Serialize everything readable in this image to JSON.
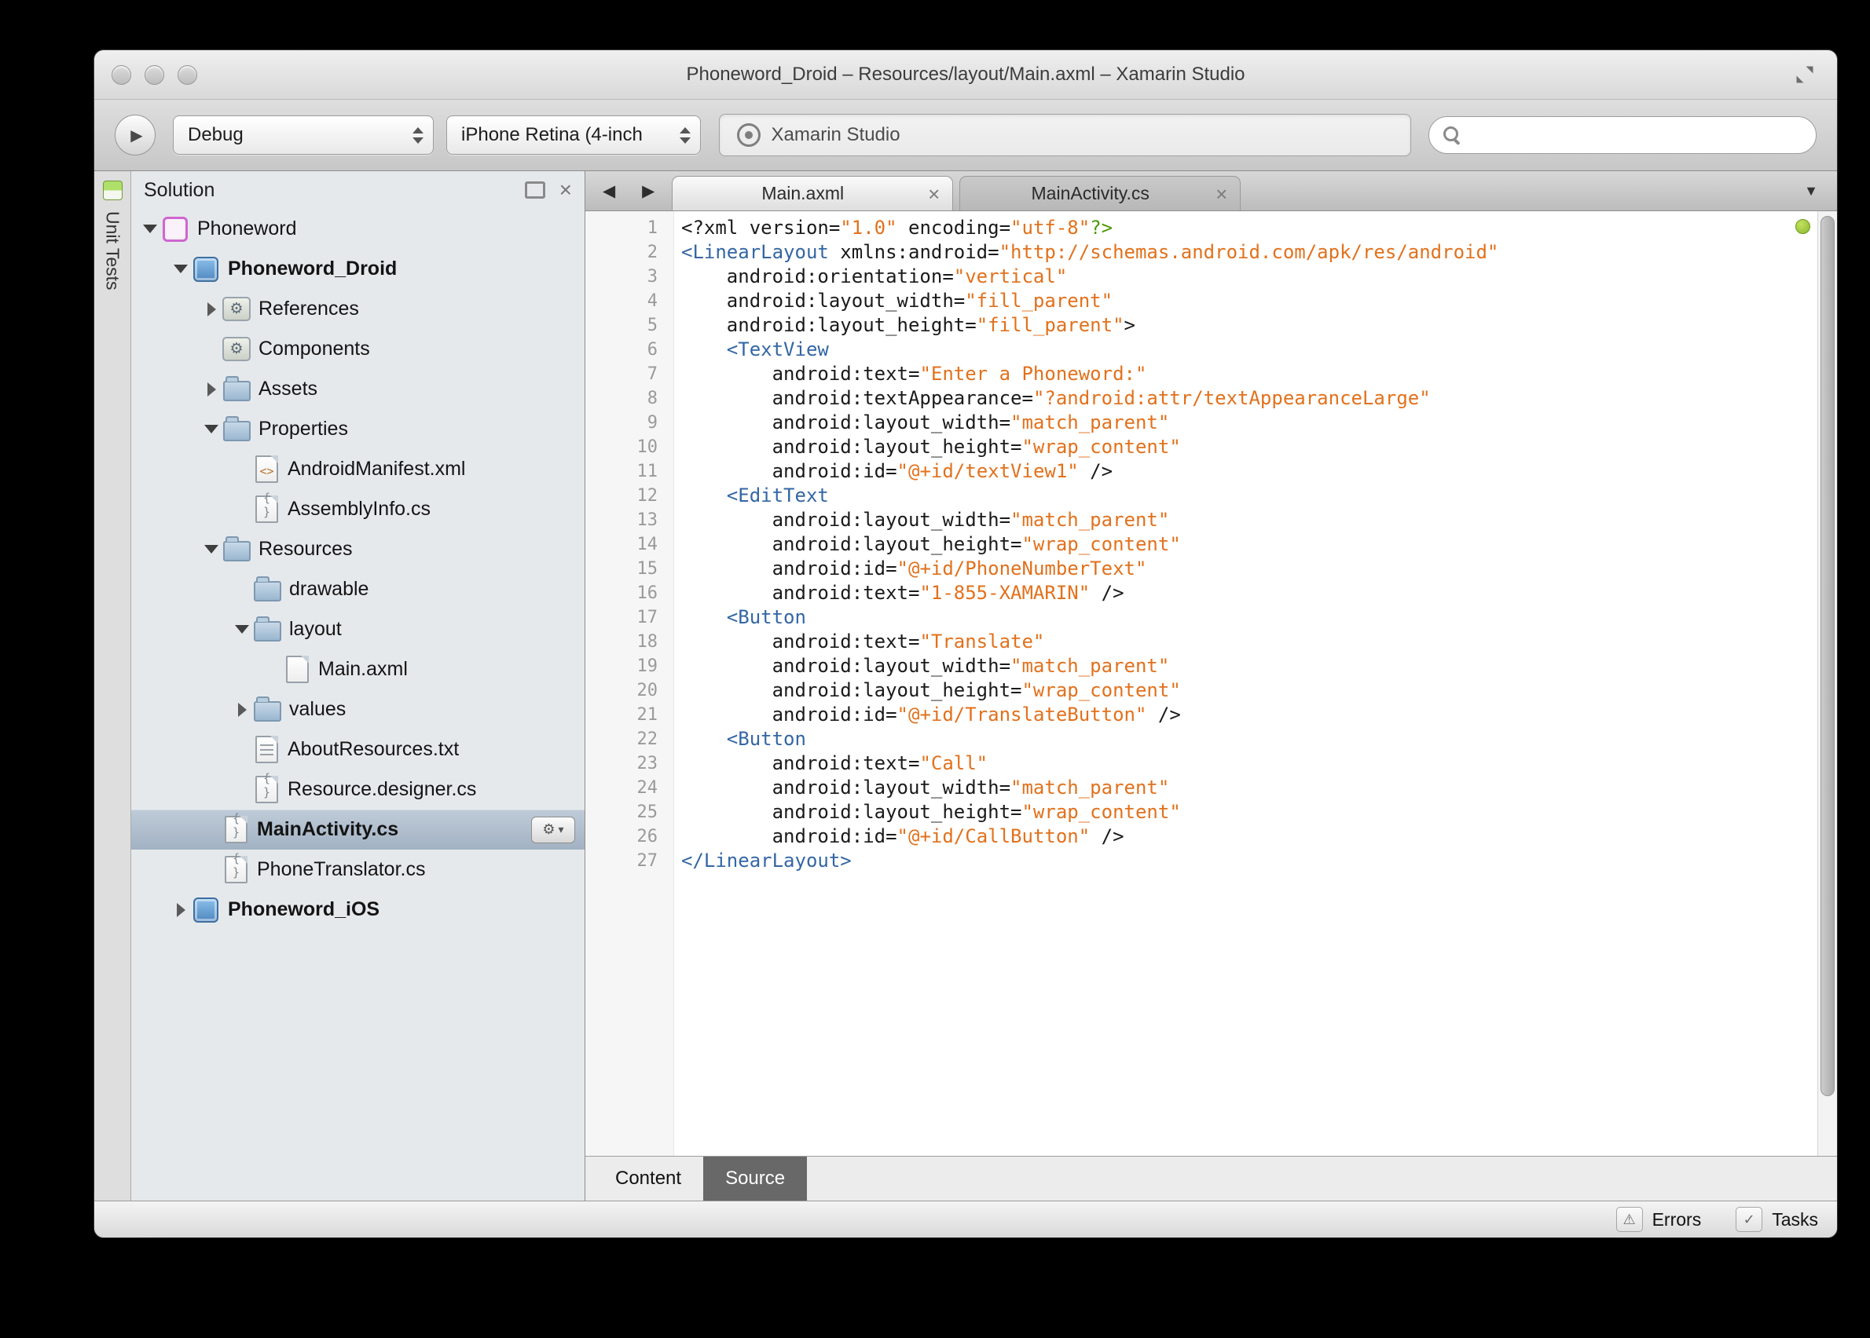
{
  "window": {
    "title": "Phoneword_Droid – Resources/layout/Main.axml – Xamarin Studio"
  },
  "toolbar": {
    "configuration": "Debug",
    "device": "iPhone Retina (4-inch",
    "status_text": "Xamarin Studio"
  },
  "unit_tests_label": "Unit Tests",
  "solution_panel": {
    "title": "Solution",
    "tree": [
      {
        "label": "Phoneword",
        "level": 0,
        "expander": "down",
        "icon": "solution"
      },
      {
        "label": "Phoneword_Droid",
        "level": 1,
        "expander": "down",
        "icon": "project",
        "bold": true
      },
      {
        "label": "References",
        "level": 2,
        "expander": "right",
        "icon": "references"
      },
      {
        "label": "Components",
        "level": 2,
        "expander": "none",
        "icon": "components"
      },
      {
        "label": "Assets",
        "level": 2,
        "expander": "right",
        "icon": "folder"
      },
      {
        "label": "Properties",
        "level": 2,
        "expander": "down",
        "icon": "folder"
      },
      {
        "label": "AndroidManifest.xml",
        "level": 3,
        "expander": "none",
        "icon": "file-xml"
      },
      {
        "label": "AssemblyInfo.cs",
        "level": 3,
        "expander": "none",
        "icon": "file-cs"
      },
      {
        "label": "Resources",
        "level": 2,
        "expander": "down",
        "icon": "folder"
      },
      {
        "label": "drawable",
        "level": 3,
        "expander": "none",
        "icon": "folder"
      },
      {
        "label": "layout",
        "level": 3,
        "expander": "down",
        "icon": "folder"
      },
      {
        "label": "Main.axml",
        "level": 4,
        "expander": "none",
        "icon": "file-plain"
      },
      {
        "label": "values",
        "level": 3,
        "expander": "right",
        "icon": "folder"
      },
      {
        "label": "AboutResources.txt",
        "level": 3,
        "expander": "none",
        "icon": "file-txt"
      },
      {
        "label": "Resource.designer.cs",
        "level": 3,
        "expander": "none",
        "icon": "file-cs"
      },
      {
        "label": "MainActivity.cs",
        "level": 2,
        "expander": "none",
        "icon": "file-cs",
        "selected": true,
        "gear": true,
        "bold": true
      },
      {
        "label": "PhoneTranslator.cs",
        "level": 2,
        "expander": "none",
        "icon": "file-cs"
      },
      {
        "label": "Phoneword_iOS",
        "level": 1,
        "expander": "right",
        "icon": "project",
        "bold": true
      }
    ]
  },
  "editor": {
    "tabs": [
      {
        "label": "Main.axml",
        "active": true
      },
      {
        "label": "MainActivity.cs",
        "active": false
      }
    ],
    "bottom_tabs": [
      {
        "label": "Content",
        "active": false
      },
      {
        "label": "Source",
        "active": true
      }
    ],
    "code_lines": [
      {
        "n": 1,
        "tokens": [
          [
            "p",
            "<?xml version="
          ],
          [
            "v",
            "\"1.0\""
          ],
          [
            "p",
            " encoding="
          ],
          [
            "v",
            "\"utf-8\""
          ],
          [
            "g",
            "?>"
          ]
        ]
      },
      {
        "n": 2,
        "tokens": [
          [
            "t",
            "<LinearLayout"
          ],
          [
            "p",
            " xmlns:android="
          ],
          [
            "v",
            "\"http://schemas.android.com/apk/res/android\""
          ]
        ]
      },
      {
        "n": 3,
        "tokens": [
          [
            "p",
            "    android:orientation="
          ],
          [
            "v",
            "\"vertical\""
          ]
        ]
      },
      {
        "n": 4,
        "tokens": [
          [
            "p",
            "    android:layout_width="
          ],
          [
            "v",
            "\"fill_parent\""
          ]
        ]
      },
      {
        "n": 5,
        "tokens": [
          [
            "p",
            "    android:layout_height="
          ],
          [
            "v",
            "\"fill_parent\""
          ],
          [
            "p",
            ">"
          ]
        ]
      },
      {
        "n": 6,
        "tokens": [
          [
            "p",
            "    "
          ],
          [
            "t",
            "<TextView"
          ]
        ]
      },
      {
        "n": 7,
        "tokens": [
          [
            "p",
            "        android:text="
          ],
          [
            "v",
            "\"Enter a Phoneword:\""
          ]
        ]
      },
      {
        "n": 8,
        "tokens": [
          [
            "p",
            "        android:textAppearance="
          ],
          [
            "v",
            "\"?android:attr/textAppearanceLarge\""
          ]
        ]
      },
      {
        "n": 9,
        "tokens": [
          [
            "p",
            "        android:layout_width="
          ],
          [
            "v",
            "\"match_parent\""
          ]
        ]
      },
      {
        "n": 10,
        "tokens": [
          [
            "p",
            "        android:layout_height="
          ],
          [
            "v",
            "\"wrap_content\""
          ]
        ]
      },
      {
        "n": 11,
        "tokens": [
          [
            "p",
            "        android:id="
          ],
          [
            "v",
            "\"@+id/textView1\""
          ],
          [
            "p",
            " />"
          ]
        ]
      },
      {
        "n": 12,
        "tokens": [
          [
            "p",
            "    "
          ],
          [
            "t",
            "<EditText"
          ]
        ]
      },
      {
        "n": 13,
        "tokens": [
          [
            "p",
            "        android:layout_width="
          ],
          [
            "v",
            "\"match_parent\""
          ]
        ]
      },
      {
        "n": 14,
        "tokens": [
          [
            "p",
            "        android:layout_height="
          ],
          [
            "v",
            "\"wrap_content\""
          ]
        ]
      },
      {
        "n": 15,
        "tokens": [
          [
            "p",
            "        android:id="
          ],
          [
            "v",
            "\"@+id/PhoneNumberText\""
          ]
        ]
      },
      {
        "n": 16,
        "tokens": [
          [
            "p",
            "        android:text="
          ],
          [
            "v",
            "\"1-855-XAMARIN\""
          ],
          [
            "p",
            " />"
          ]
        ]
      },
      {
        "n": 17,
        "tokens": [
          [
            "p",
            "    "
          ],
          [
            "t",
            "<Button"
          ]
        ]
      },
      {
        "n": 18,
        "tokens": [
          [
            "p",
            "        android:text="
          ],
          [
            "v",
            "\"Translate\""
          ]
        ]
      },
      {
        "n": 19,
        "tokens": [
          [
            "p",
            "        android:layout_width="
          ],
          [
            "v",
            "\"match_parent\""
          ]
        ]
      },
      {
        "n": 20,
        "tokens": [
          [
            "p",
            "        android:layout_height="
          ],
          [
            "v",
            "\"wrap_content\""
          ]
        ]
      },
      {
        "n": 21,
        "tokens": [
          [
            "p",
            "        android:id="
          ],
          [
            "v",
            "\"@+id/TranslateButton\""
          ],
          [
            "p",
            " />"
          ]
        ]
      },
      {
        "n": 22,
        "tokens": [
          [
            "p",
            "    "
          ],
          [
            "t",
            "<Button"
          ]
        ]
      },
      {
        "n": 23,
        "tokens": [
          [
            "p",
            "        android:text="
          ],
          [
            "v",
            "\"Call\""
          ]
        ]
      },
      {
        "n": 24,
        "tokens": [
          [
            "p",
            "        android:layout_width="
          ],
          [
            "v",
            "\"match_parent\""
          ]
        ]
      },
      {
        "n": 25,
        "tokens": [
          [
            "p",
            "        android:layout_height="
          ],
          [
            "v",
            "\"wrap_content\""
          ]
        ]
      },
      {
        "n": 26,
        "tokens": [
          [
            "p",
            "        android:id="
          ],
          [
            "v",
            "\"@+id/CallButton\""
          ],
          [
            "p",
            " />"
          ]
        ]
      },
      {
        "n": 27,
        "tokens": [
          [
            "t",
            "</LinearLayout>"
          ]
        ]
      }
    ]
  },
  "status_bar": {
    "errors": "Errors",
    "tasks": "Tasks"
  },
  "icons": {
    "play": "▶",
    "back": "◀",
    "forward": "▶",
    "tab_list": "▼",
    "close": "×",
    "gear": "⚙",
    "warning": "⚠",
    "check": "✓",
    "caret_down": "▾"
  },
  "colors": {
    "tag_blue": "#3366a4",
    "value_orange": "#e2711c",
    "pi_green": "#4e9a06",
    "selection_blue": "#a2b2c3",
    "health_green": "#8ab82e"
  }
}
